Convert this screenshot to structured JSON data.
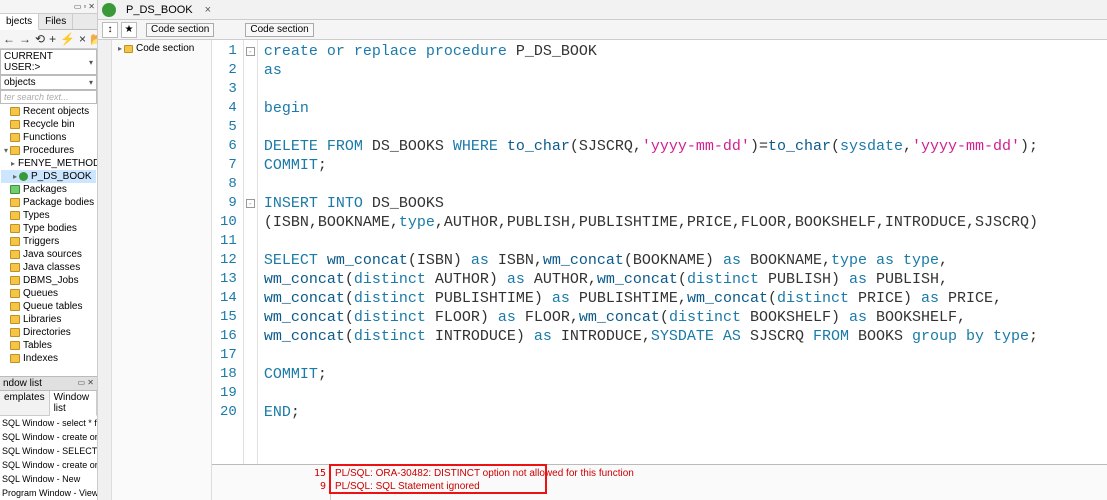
{
  "left": {
    "tabs": [
      "bjects",
      "Files"
    ],
    "toolbar_icons": [
      "←",
      "→",
      "⟲",
      "+",
      "⚡",
      "×",
      "📂"
    ],
    "user_combo": "CURRENT USER:>",
    "objects_combo": "objects",
    "search_placeholder": "ter search text...",
    "tree": [
      {
        "label": "Recent objects",
        "icon": "folder"
      },
      {
        "label": "Recycle bin",
        "icon": "folder"
      },
      {
        "label": "Functions",
        "icon": "folder"
      },
      {
        "label": "Procedures",
        "icon": "folder",
        "expanded": true,
        "children": [
          {
            "label": "FENYE_METHOD",
            "icon": "proc"
          },
          {
            "label": "P_DS_BOOK",
            "icon": "proc",
            "selected": true
          }
        ]
      },
      {
        "label": "Packages",
        "icon": "folder-green"
      },
      {
        "label": "Package bodies",
        "icon": "folder"
      },
      {
        "label": "Types",
        "icon": "folder"
      },
      {
        "label": "Type bodies",
        "icon": "folder"
      },
      {
        "label": "Triggers",
        "icon": "folder"
      },
      {
        "label": "Java sources",
        "icon": "folder"
      },
      {
        "label": "Java classes",
        "icon": "folder"
      },
      {
        "label": "DBMS_Jobs",
        "icon": "folder"
      },
      {
        "label": "Queues",
        "icon": "folder"
      },
      {
        "label": "Queue tables",
        "icon": "folder"
      },
      {
        "label": "Libraries",
        "icon": "folder"
      },
      {
        "label": "Directories",
        "icon": "folder"
      },
      {
        "label": "Tables",
        "icon": "folder"
      },
      {
        "label": "Indexes",
        "icon": "folder"
      }
    ],
    "window_list_header": "ndow list",
    "sub_tabs": [
      "emplates",
      "Window list"
    ],
    "history": [
      "SQL Window - select * from ds_boo",
      "SQL Window - create or replace pro",
      "SQL Window - SELECT ISBN,BOO",
      "SQL Window - create or replace pro",
      "SQL Window - New",
      "Program Window - View source of"
    ]
  },
  "editor": {
    "tab_label": "P_DS_BOOK",
    "code_section_chip": "Code section",
    "code_section_tree_item": "Code section",
    "code": [
      [
        [
          "kw",
          "create or replace procedure "
        ],
        [
          "id",
          "P_DS_BOOK"
        ]
      ],
      [
        [
          "kw",
          "as"
        ]
      ],
      [
        [
          "id",
          ""
        ]
      ],
      [
        [
          "kw",
          "begin"
        ]
      ],
      [
        [
          "id",
          ""
        ]
      ],
      [
        [
          "kw",
          "DELETE FROM "
        ],
        [
          "id",
          "DS_BOOKS "
        ],
        [
          "kw",
          "WHERE "
        ],
        [
          "fn",
          "to_char"
        ],
        [
          "id",
          "(SJSCRQ,"
        ],
        [
          "str",
          "'yyyy-mm-dd'"
        ],
        [
          "id",
          ")="
        ],
        [
          "fn",
          "to_char"
        ],
        [
          "id",
          "("
        ],
        [
          "kw",
          "sysdate"
        ],
        [
          "id",
          ","
        ],
        [
          "str",
          "'yyyy-mm-dd'"
        ],
        [
          "id",
          ");"
        ]
      ],
      [
        [
          "kw",
          "COMMIT"
        ],
        [
          "id",
          ";"
        ]
      ],
      [
        [
          "id",
          ""
        ]
      ],
      [
        [
          "kw",
          "INSERT INTO "
        ],
        [
          "id",
          "DS_BOOKS"
        ]
      ],
      [
        [
          "id",
          "(ISBN,BOOKNAME,"
        ],
        [
          "kw",
          "type"
        ],
        [
          "id",
          ",AUTHOR,PUBLISH,PUBLISHTIME,PRICE,FLOOR,BOOKSHELF,INTRODUCE,SJSCRQ)"
        ]
      ],
      [
        [
          "id",
          ""
        ]
      ],
      [
        [
          "kw",
          "SELECT "
        ],
        [
          "fn",
          "wm_concat"
        ],
        [
          "id",
          "(ISBN) "
        ],
        [
          "kw",
          "as "
        ],
        [
          "id",
          "ISBN,"
        ],
        [
          "fn",
          "wm_concat"
        ],
        [
          "id",
          "(BOOKNAME) "
        ],
        [
          "kw",
          "as "
        ],
        [
          "id",
          "BOOKNAME,"
        ],
        [
          "kw",
          "type as type"
        ],
        [
          "id",
          ","
        ]
      ],
      [
        [
          "fn",
          "wm_concat"
        ],
        [
          "id",
          "("
        ],
        [
          "kw",
          "distinct "
        ],
        [
          "id",
          "AUTHOR) "
        ],
        [
          "kw",
          "as "
        ],
        [
          "id",
          "AUTHOR,"
        ],
        [
          "fn",
          "wm_concat"
        ],
        [
          "id",
          "("
        ],
        [
          "kw",
          "distinct "
        ],
        [
          "id",
          "PUBLISH) "
        ],
        [
          "kw",
          "as "
        ],
        [
          "id",
          "PUBLISH,"
        ]
      ],
      [
        [
          "fn",
          "wm_concat"
        ],
        [
          "id",
          "("
        ],
        [
          "kw",
          "distinct "
        ],
        [
          "id",
          "PUBLISHTIME) "
        ],
        [
          "kw",
          "as "
        ],
        [
          "id",
          "PUBLISHTIME,"
        ],
        [
          "fn",
          "wm_concat"
        ],
        [
          "id",
          "("
        ],
        [
          "kw",
          "distinct "
        ],
        [
          "id",
          "PRICE) "
        ],
        [
          "kw",
          "as "
        ],
        [
          "id",
          "PRICE,"
        ]
      ],
      [
        [
          "fn",
          "wm_concat"
        ],
        [
          "id",
          "("
        ],
        [
          "kw",
          "distinct "
        ],
        [
          "id",
          "FLOOR) "
        ],
        [
          "kw",
          "as "
        ],
        [
          "id",
          "FLOOR,"
        ],
        [
          "fn",
          "wm_concat"
        ],
        [
          "id",
          "("
        ],
        [
          "kw",
          "distinct "
        ],
        [
          "id",
          "BOOKSHELF) "
        ],
        [
          "kw",
          "as "
        ],
        [
          "id",
          "BOOKSHELF,"
        ]
      ],
      [
        [
          "fn",
          "wm_concat"
        ],
        [
          "id",
          "("
        ],
        [
          "kw",
          "distinct "
        ],
        [
          "id",
          "INTRODUCE) "
        ],
        [
          "kw",
          "as "
        ],
        [
          "id",
          "INTRODUCE,"
        ],
        [
          "kw",
          "SYSDATE AS "
        ],
        [
          "id",
          "SJSCRQ "
        ],
        [
          "kw",
          "FROM "
        ],
        [
          "id",
          "BOOKS "
        ],
        [
          "kw",
          "group by type"
        ],
        [
          "id",
          ";"
        ]
      ],
      [
        [
          "id",
          ""
        ]
      ],
      [
        [
          "kw",
          "COMMIT"
        ],
        [
          "id",
          ";"
        ]
      ],
      [
        [
          "id",
          ""
        ]
      ],
      [
        [
          "kw",
          "END"
        ],
        [
          "id",
          ";"
        ]
      ]
    ],
    "fold_marks": {
      "1": "-",
      "9": "-"
    },
    "errors": {
      "gutter": [
        "15",
        "9"
      ],
      "lines": [
        "PL/SQL: ORA-30482: DISTINCT option not allowed for this function",
        "PL/SQL: SQL Statement ignored"
      ]
    }
  }
}
